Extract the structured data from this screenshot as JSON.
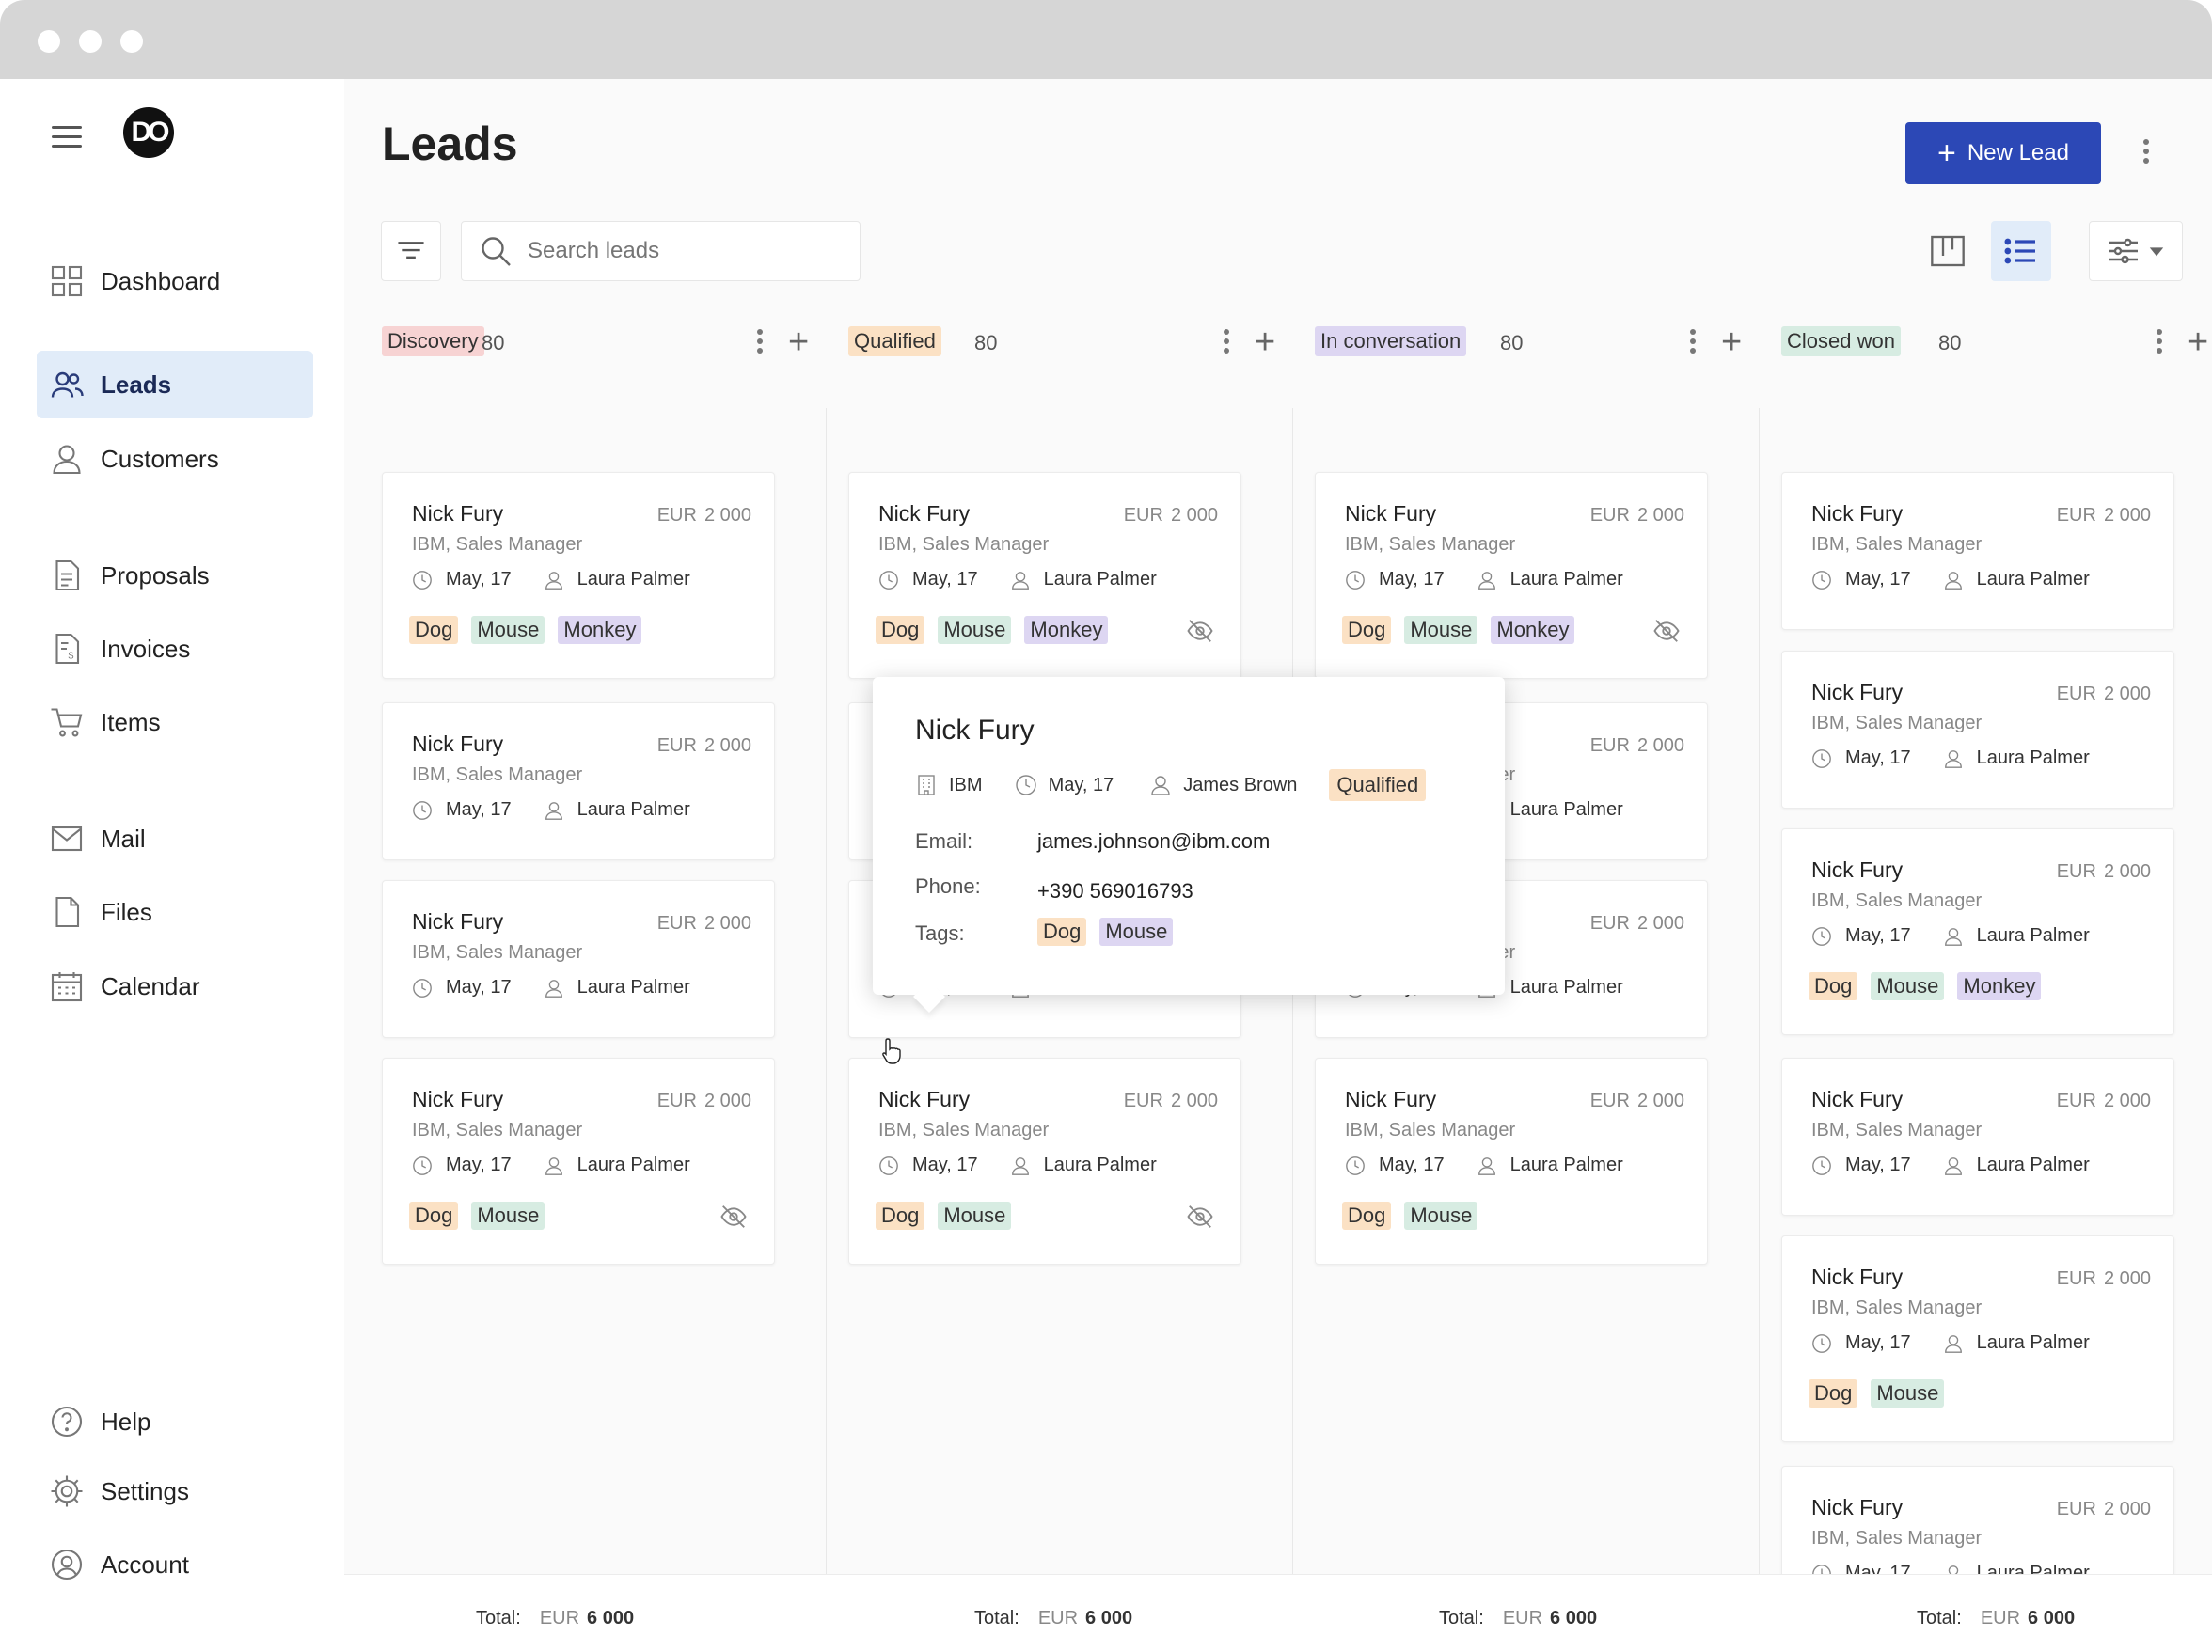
{
  "sidebar": {
    "logo_text": "DO",
    "items": [
      {
        "label": "Dashboard",
        "icon": "dashboard-icon"
      },
      {
        "label": "Leads",
        "icon": "users-icon"
      },
      {
        "label": "Customers",
        "icon": "user-icon"
      },
      {
        "label": "Proposals",
        "icon": "document-icon"
      },
      {
        "label": "Invoices",
        "icon": "invoice-icon"
      },
      {
        "label": "Items",
        "icon": "cart-icon"
      },
      {
        "label": "Mail",
        "icon": "mail-icon"
      },
      {
        "label": "Files",
        "icon": "file-icon"
      },
      {
        "label": "Calendar",
        "icon": "calendar-icon"
      },
      {
        "label": "Help",
        "icon": "help-icon"
      },
      {
        "label": "Settings",
        "icon": "gear-icon"
      },
      {
        "label": "Account",
        "icon": "account-icon"
      }
    ]
  },
  "header": {
    "title": "Leads",
    "new_button": "New Lead",
    "search_placeholder": "Search leads"
  },
  "columns": [
    {
      "stage": "Discovery",
      "count": "80",
      "color": "#f7d3d3",
      "total_label": "Total:",
      "total_currency": "EUR",
      "total_value": "6 000"
    },
    {
      "stage": "Qualified",
      "count": "80",
      "color": "#fbe1c4",
      "total_label": "Total:",
      "total_currency": "EUR",
      "total_value": "6 000"
    },
    {
      "stage": "In conversation",
      "count": "80",
      "color": "#ddd6f2",
      "total_label": "Total:",
      "total_currency": "EUR",
      "total_value": "6 000"
    },
    {
      "stage": "Closed won",
      "count": "80",
      "color": "#d7ece2",
      "total_label": "Total:",
      "total_currency": "EUR",
      "total_value": "6 000"
    }
  ],
  "card": {
    "name": "Nick Fury",
    "subtitle": "IBM, Sales Manager",
    "currency": "EUR",
    "amount": "2 000",
    "date": "May, 17",
    "owner": "Laura Palmer",
    "tags": [
      "Dog",
      "Mouse",
      "Monkey"
    ]
  },
  "popover": {
    "name": "Nick Fury",
    "company": "IBM",
    "date": "May, 17",
    "owner": "James Brown",
    "stage": "Qualified",
    "email_label": "Email:",
    "email": "james.johnson@ibm.com",
    "phone_label": "Phone:",
    "phone": "+390 569016793",
    "tags_label": "Tags:",
    "tags": [
      "Dog",
      "Mouse"
    ]
  }
}
